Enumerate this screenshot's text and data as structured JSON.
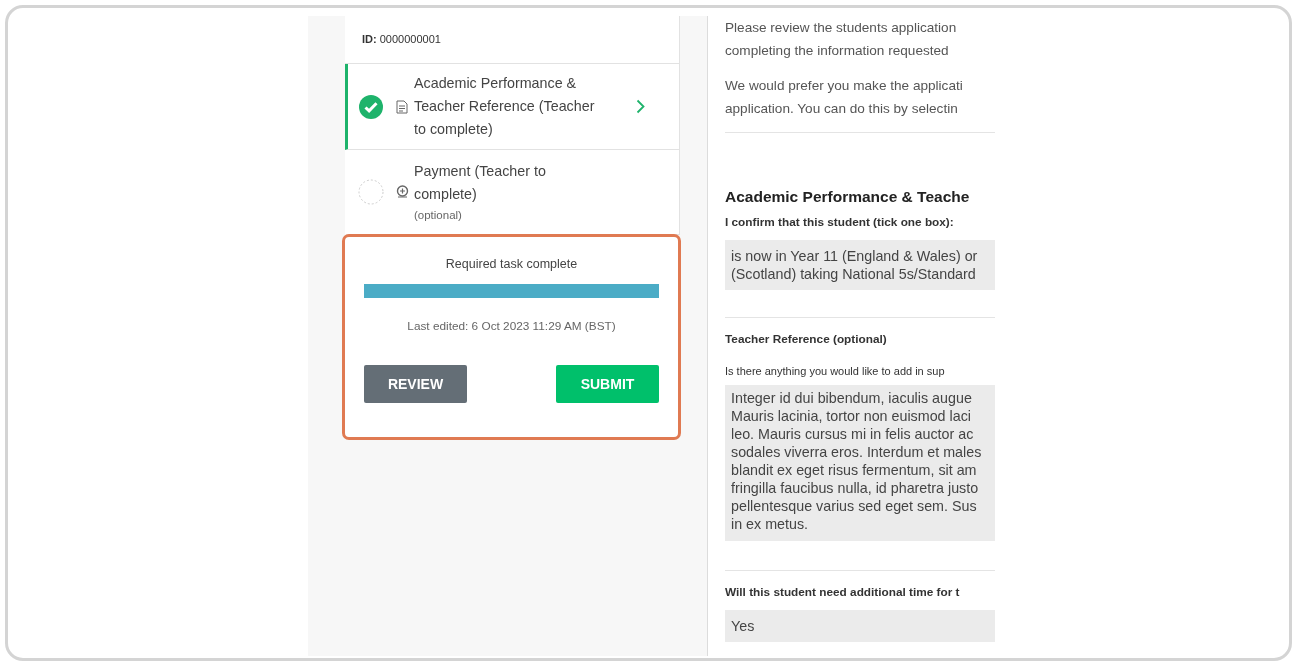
{
  "record": {
    "id_label": "ID:",
    "id_value": "0000000001"
  },
  "steps": [
    {
      "kind": "form",
      "title_lines": [
        "Academic Performance &",
        "Teacher Reference (Teacher",
        "to complete)"
      ],
      "completed": true,
      "selected": true
    },
    {
      "kind": "payment",
      "title_lines": [
        "Payment (Teacher to",
        "complete)"
      ],
      "note": "(optional)",
      "completed": false,
      "selected": false
    }
  ],
  "progress": {
    "label": "Required task complete",
    "level": 1,
    "last_edited": "Last edited: 6 Oct 2023 11:29 AM (BST)"
  },
  "buttons": [
    {
      "kind": "secondary",
      "label": "REVIEW"
    },
    {
      "kind": "primary",
      "label": "SUBMIT"
    }
  ],
  "intro": [
    {
      "lines": [
        "Please review the students application",
        "completing the information requested"
      ]
    },
    {
      "lines": [
        "We would prefer you make the applicati",
        "application. You can do this by selectin"
      ]
    }
  ],
  "section": {
    "title": "Academic Performance & Teache",
    "questions": [
      {
        "kind": "choice",
        "label": "I confirm that this student (tick one box):",
        "answer_lines": [
          "is now in Year 11 (England & Wales) or",
          "(Scotland) taking National 5s/Standard"
        ]
      },
      {
        "kind": "text",
        "heading": "Teacher Reference (optional)",
        "label": "Is there anything you would like to add in sup",
        "answer_lines": [
          "Integer id dui bibendum, iaculis augue",
          "Mauris lacinia, tortor non euismod laci",
          "leo. Mauris cursus mi in felis auctor ac",
          "sodales viverra eros. Interdum et males",
          "blandit ex eget risus fermentum, sit am",
          "fringilla faucibus nulla, id pharetra justo",
          "pellentesque varius sed eget sem. Sus",
          "in ex metus."
        ]
      },
      {
        "kind": "choice",
        "label": "Will this student need additional time for t",
        "answer_lines": [
          "Yes"
        ]
      }
    ]
  }
}
